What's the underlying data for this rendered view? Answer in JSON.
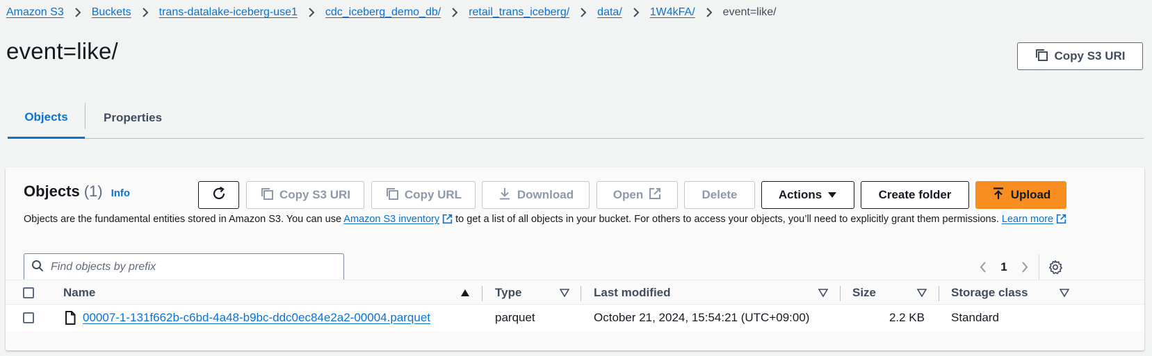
{
  "breadcrumb": {
    "items": [
      "Amazon S3",
      "Buckets",
      "trans-datalake-iceberg-use1",
      "cdc_iceberg_demo_db/",
      "retail_trans_iceberg/",
      "data/",
      "1W4kFA/"
    ],
    "current": "event=like/"
  },
  "page": {
    "title": "event=like/",
    "copy_s3_uri": "Copy S3 URI"
  },
  "tabs": [
    {
      "label": "Objects",
      "active": true
    },
    {
      "label": "Properties",
      "active": false
    }
  ],
  "objects_panel": {
    "title": "Objects",
    "count": "(1)",
    "info": "Info",
    "toolbar": {
      "refresh_icon": "refresh-icon",
      "copy_s3_uri": "Copy S3 URI",
      "copy_url": "Copy URL",
      "download": "Download",
      "open": "Open",
      "delete": "Delete",
      "actions": "Actions",
      "create_folder": "Create folder",
      "upload": "Upload"
    },
    "description": {
      "part1": "Objects are the fundamental entities stored in Amazon S3. You can use ",
      "inventory_link": "Amazon S3 inventory",
      "part2": " to get a list of all objects in your bucket. For others to access your objects, you’ll need to explicitly grant them permissions. ",
      "learn_more_link": "Learn more"
    },
    "search": {
      "placeholder": "Find objects by prefix",
      "value": ""
    },
    "pagination": {
      "current_page": "1"
    },
    "table": {
      "columns": [
        "Name",
        "Type",
        "Last modified",
        "Size",
        "Storage class"
      ],
      "rows": [
        {
          "name": "00007-1-131f662b-c6bd-4a48-b9bc-ddc0ec84e2a2-00004.parquet",
          "type": "parquet",
          "last_modified": "October 21, 2024, 15:54:21 (UTC+09:00)",
          "size": "2.2 KB",
          "storage_class": "Standard"
        }
      ]
    }
  },
  "colors": {
    "link": "#0972d3",
    "primary_button": "#f88e1f",
    "background": "#f2f3f3",
    "text": "#16191f"
  }
}
